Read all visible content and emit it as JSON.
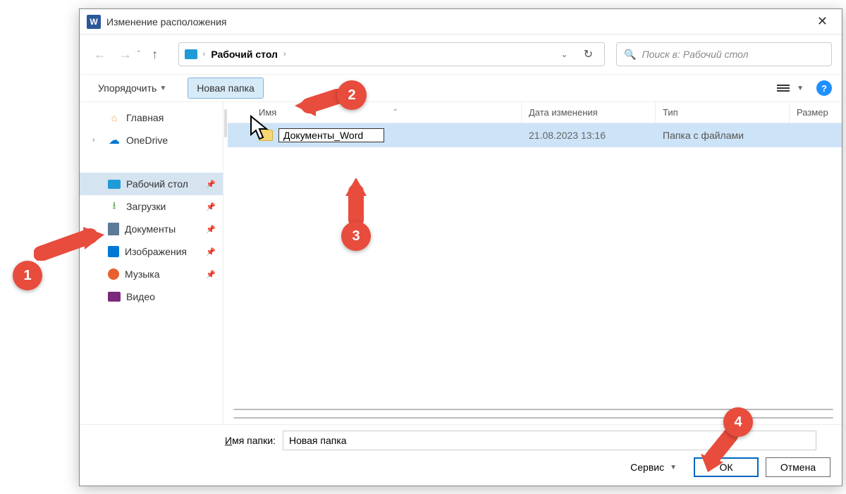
{
  "title": "Изменение расположения",
  "breadcrumb": {
    "root": "Рабочий стол"
  },
  "search": {
    "placeholder": "Поиск в: Рабочий стол"
  },
  "toolbar": {
    "organize": "Упорядочить",
    "newfolder": "Новая папка"
  },
  "sidebar": {
    "home": "Главная",
    "onedrive": "OneDrive",
    "desktop": "Рабочий стол",
    "downloads": "Загрузки",
    "documents": "Документы",
    "images": "Изображения",
    "music": "Музыка",
    "video": "Видео"
  },
  "columns": {
    "name": "Имя",
    "date": "Дата изменения",
    "type": "Тип",
    "size": "Размер"
  },
  "files": [
    {
      "name": "Документы_Word",
      "date": "21.08.2023 13:16",
      "type": "Папка с файлами"
    }
  ],
  "footer": {
    "label_prefix": "И",
    "label_rest": "мя папки:",
    "value": "Новая папка",
    "service": "Сервис",
    "ok": "ОК",
    "cancel": "Отмена"
  },
  "annotations": {
    "n1": "1",
    "n2": "2",
    "n3": "3",
    "n4": "4"
  }
}
